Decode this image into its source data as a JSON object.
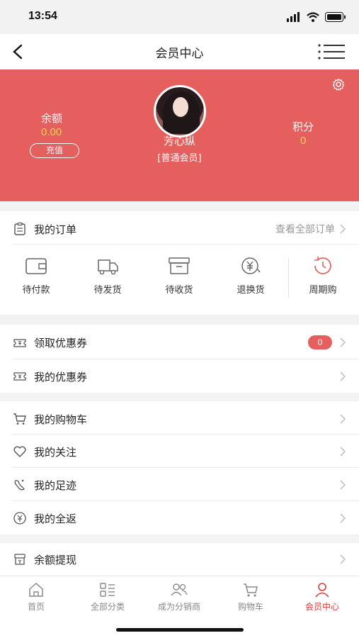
{
  "status": {
    "time": "13:54"
  },
  "nav": {
    "title": "会员中心"
  },
  "profile": {
    "name": "芳心纵",
    "level": "[普通会员]",
    "balance_label": "余额",
    "balance_value": "0.00",
    "recharge_label": "充值",
    "points_label": "积分",
    "points_value": "0"
  },
  "orders": {
    "title": "我的订单",
    "view_all": "查看全部订单",
    "items": [
      {
        "label": "待付款",
        "icon": "wallet-icon"
      },
      {
        "label": "待发货",
        "icon": "truck-icon"
      },
      {
        "label": "待收货",
        "icon": "box-icon"
      },
      {
        "label": "退换货",
        "icon": "yen-return-icon"
      },
      {
        "label": "周期购",
        "icon": "clock-cycle-icon"
      }
    ]
  },
  "coupons": {
    "get_label": "领取优惠券",
    "get_badge": "0",
    "mine_label": "我的优惠券"
  },
  "menu": [
    {
      "label": "我的购物车",
      "icon": "cart-icon"
    },
    {
      "label": "我的关注",
      "icon": "heart-icon"
    },
    {
      "label": "我的足迹",
      "icon": "footprint-icon"
    },
    {
      "label": "我的全返",
      "icon": "rebate-icon"
    }
  ],
  "withdraw": {
    "label": "余额提现",
    "icon": "withdraw-icon"
  },
  "tabs": [
    {
      "label": "首页",
      "icon": "home-icon"
    },
    {
      "label": "全部分类",
      "icon": "category-icon"
    },
    {
      "label": "成为分销商",
      "icon": "distributor-icon"
    },
    {
      "label": "购物车",
      "icon": "cart-icon"
    },
    {
      "label": "会员中心",
      "icon": "user-icon",
      "active": true
    }
  ],
  "colors": {
    "accent": "#e45f5e",
    "highlight": "#ffd24d",
    "active_tab": "#d83b3b"
  }
}
